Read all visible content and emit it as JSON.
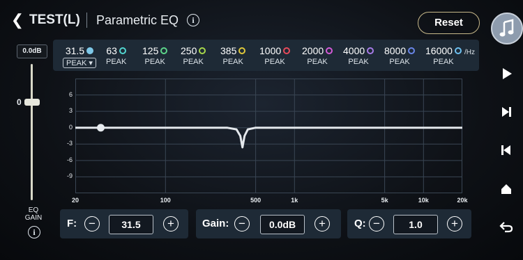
{
  "header": {
    "back_icon": "chevron-left-icon",
    "channel": "TEST(L)",
    "title": "Parametric EQ",
    "info_glyph": "i",
    "reset_label": "Reset"
  },
  "rail": {
    "icons": [
      "music-note-icon",
      "play-icon",
      "next-track-icon",
      "previous-track-icon",
      "home-icon",
      "return-icon"
    ]
  },
  "gain": {
    "value": "0.0dB",
    "zero_label": "0",
    "label": "EQ\nGAIN",
    "info_glyph": "i",
    "level_db": 0
  },
  "bands": [
    {
      "freq": "31.5",
      "type": "PEAK",
      "color": "#7ec8e8",
      "selected": true
    },
    {
      "freq": "63",
      "type": "PEAK",
      "color": "#52d6d0",
      "selected": false
    },
    {
      "freq": "125",
      "type": "PEAK",
      "color": "#5dd68a",
      "selected": false
    },
    {
      "freq": "250",
      "type": "PEAK",
      "color": "#a8d84a",
      "selected": false
    },
    {
      "freq": "385",
      "type": "PEAK",
      "color": "#e0c83a",
      "selected": false
    },
    {
      "freq": "1000",
      "type": "PEAK",
      "color": "#e84a5a",
      "selected": false
    },
    {
      "freq": "2000",
      "type": "PEAK",
      "color": "#d45ad8",
      "selected": false
    },
    {
      "freq": "4000",
      "type": "PEAK",
      "color": "#a77be8",
      "selected": false
    },
    {
      "freq": "8000",
      "type": "PEAK",
      "color": "#6a86e8",
      "selected": false
    },
    {
      "freq": "16000",
      "type": "PEAK",
      "color": "#6ec0f0",
      "selected": false
    }
  ],
  "unit_label": "/Hz",
  "chart_data": {
    "type": "line",
    "y_ticks": [
      "6",
      "3",
      "0",
      "-3",
      "-6",
      "-9"
    ],
    "x_ticks": [
      "20",
      "100",
      "500",
      "1k",
      "5k",
      "10k",
      "20k"
    ],
    "x_tick_hz": [
      20,
      100,
      500,
      1000,
      5000,
      10000,
      20000
    ],
    "ylim": [
      -12,
      9
    ],
    "x_scale": "log",
    "grid": true,
    "series": [
      {
        "points": [
          [
            20,
            0
          ],
          [
            300,
            0
          ],
          [
            355,
            -0.3
          ],
          [
            380,
            -1.5
          ],
          [
            395,
            -3.6
          ],
          [
            410,
            -1.5
          ],
          [
            435,
            -0.3
          ],
          [
            500,
            0
          ],
          [
            20000,
            0
          ]
        ]
      }
    ],
    "selected_point": {
      "hz": 31.5,
      "gain": 0
    }
  },
  "controls": {
    "freq": {
      "label": "F:",
      "value": "31.5",
      "minus": "−",
      "plus": "+"
    },
    "gain": {
      "label": "Gain:",
      "value": "0.0dB",
      "minus": "−",
      "plus": "+"
    },
    "q": {
      "label": "Q:",
      "value": "1.0",
      "minus": "−",
      "plus": "+"
    }
  }
}
